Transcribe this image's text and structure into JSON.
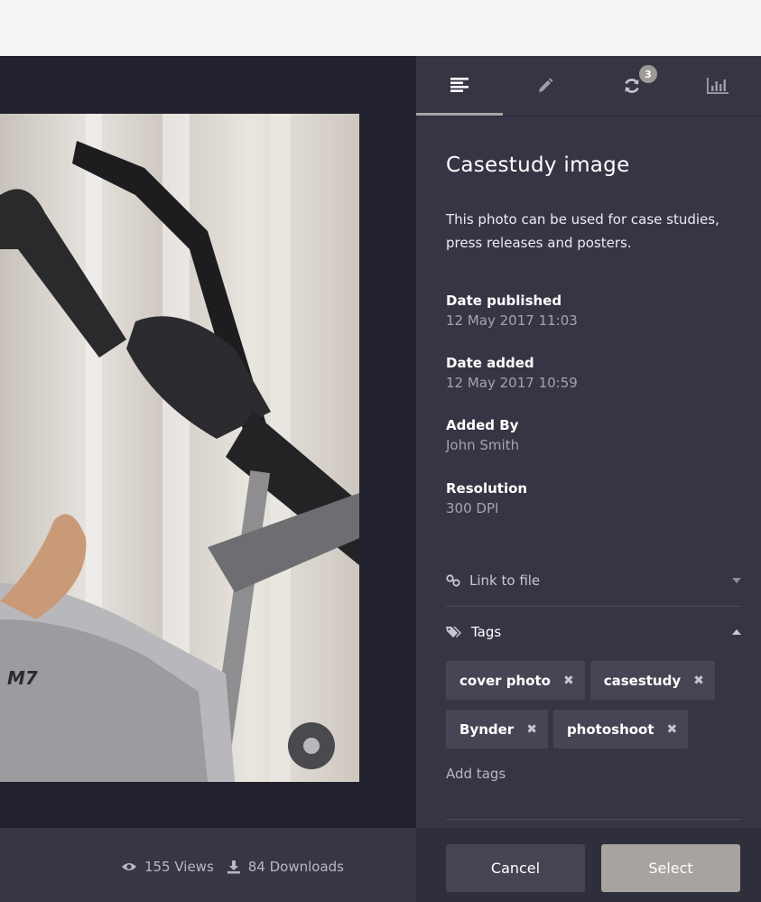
{
  "tabs": [
    {
      "icon": "details-list-icon",
      "active": true
    },
    {
      "icon": "pencil-icon",
      "active": false
    },
    {
      "icon": "sync-icon",
      "badge": "3",
      "active": false
    },
    {
      "icon": "bar-chart-icon",
      "active": false
    }
  ],
  "asset": {
    "title": "Casestudy image",
    "description": "This photo can be used for case studies, press releases and posters.",
    "meta": [
      {
        "label": "Date published",
        "value": "12 May  2017 11:03"
      },
      {
        "label": "Date added",
        "value": "12 May  2017 10:59"
      },
      {
        "label": "Added By",
        "value": "John Smith"
      },
      {
        "label": "Resolution",
        "value": "300 DPI"
      }
    ]
  },
  "link_section": {
    "label": "Link to file"
  },
  "tags_section": {
    "label": "Tags",
    "tags": [
      "cover photo",
      "casestudy",
      "Bynder",
      "photoshoot"
    ],
    "add_label": "Add tags"
  },
  "stats": {
    "views": "155 Views",
    "downloads": "84 Downloads"
  },
  "photo": {
    "brand_text": "M7"
  },
  "footer": {
    "cancel_label": "Cancel",
    "select_label": "Select"
  },
  "colors": {
    "panel": "#363544",
    "viewer": "#22222e",
    "accent": "#a9a3a0"
  }
}
